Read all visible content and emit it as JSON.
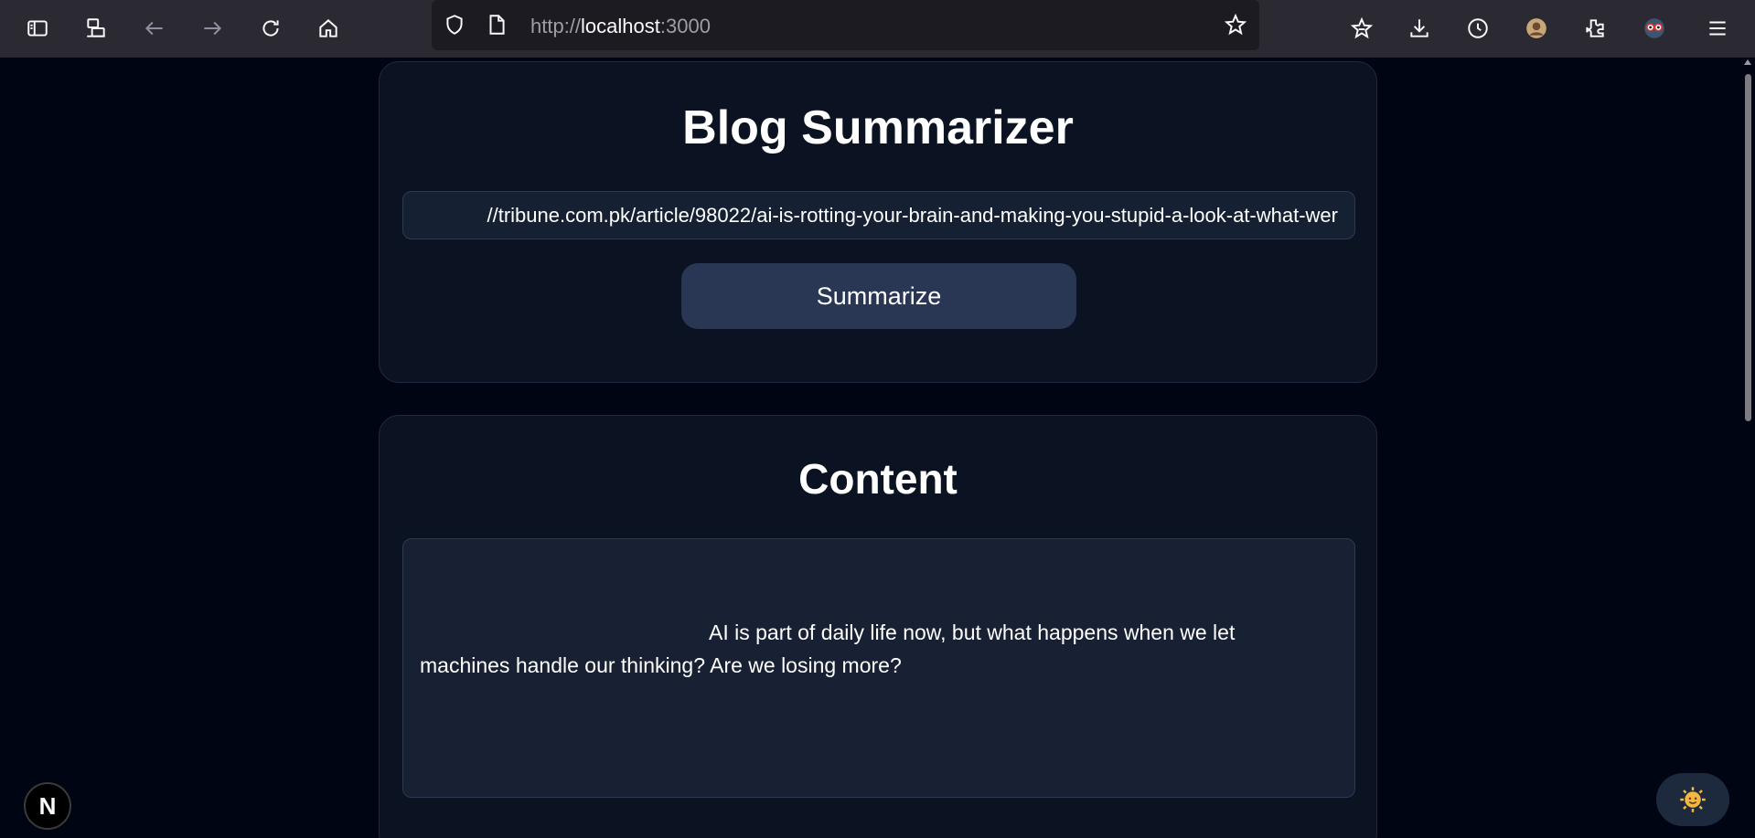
{
  "browser": {
    "url_scheme": "http://",
    "url_host": "localhost",
    "url_port": ":3000",
    "icons": [
      "sidebar-icon",
      "synced-tabs-icon",
      "back-icon",
      "forward-icon",
      "reload-icon",
      "home-icon",
      "shield-icon",
      "page-icon",
      "bookmark-star-icon",
      "saved-to-pocket-icon",
      "download-icon",
      "history-icon",
      "profile-avatar-icon",
      "extensions-icon",
      "extension-goggles-icon",
      "menu-icon"
    ]
  },
  "summarizer": {
    "title": "Blog Summarizer",
    "url_value": "//tribune.com.pk/article/98022/ai-is-rotting-your-brain-and-making-you-stupid-a-look-at-what-wer",
    "button_label": "Summarize"
  },
  "content": {
    "title": "Content",
    "text_line1": "AI is part of daily life now, but what happens when we let",
    "text_line2": "machines handle our thinking? Are we losing more?"
  },
  "widgets": {
    "next_badge": "N"
  },
  "colors": {
    "background": "#000514",
    "card": "#0b1323",
    "button": "#293754",
    "toolbar": "#2b2a33"
  }
}
